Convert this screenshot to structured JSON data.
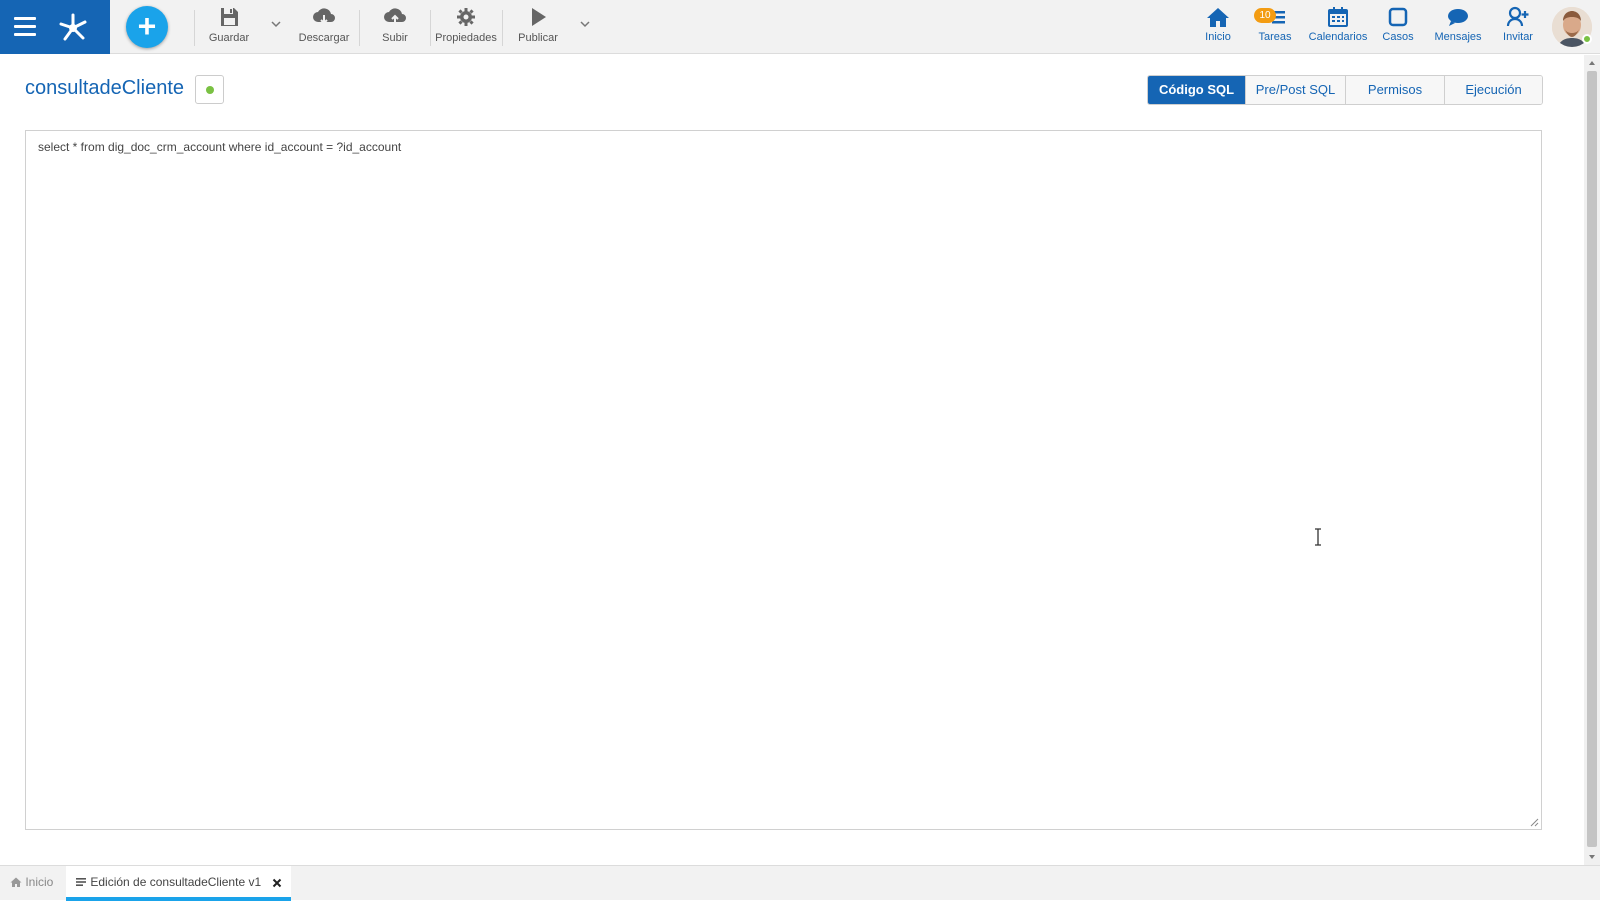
{
  "toolbar": {
    "save_label": "Guardar",
    "download_label": "Descargar",
    "upload_label": "Subir",
    "properties_label": "Propiedades",
    "publish_label": "Publicar"
  },
  "nav": {
    "home_label": "Inicio",
    "tasks_label": "Tareas",
    "tasks_badge": "10",
    "calendars_label": "Calendarios",
    "cases_label": "Casos",
    "messages_label": "Mensajes",
    "invite_label": "Invitar"
  },
  "page": {
    "title": "consultadeCliente",
    "status_color": "#7ac143"
  },
  "tabs": [
    {
      "label": "Código SQL",
      "active": true
    },
    {
      "label": "Pre/Post SQL",
      "active": false
    },
    {
      "label": "Permisos",
      "active": false
    },
    {
      "label": "Ejecución",
      "active": false
    }
  ],
  "editor": {
    "code": "select * from dig_doc_crm_account where id_account = ?id_account"
  },
  "bottom_tabs": [
    {
      "label": "Inicio",
      "icon": "home-icon",
      "active": false
    },
    {
      "label": "Edición de consultadeCliente v1",
      "icon": "form-icon",
      "active": true
    }
  ],
  "colors": {
    "brand": "#1565b4",
    "accent": "#1aa3ea",
    "badge": "#f39c12"
  }
}
